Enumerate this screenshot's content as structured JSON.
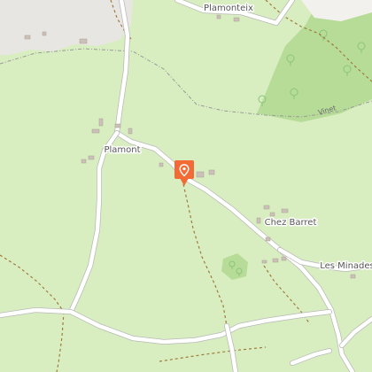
{
  "map": {
    "labels": {
      "plamonteix": "Plamonteix",
      "plamont": "Plamont",
      "chez_barret": "Chez Barret",
      "les_minades": "Les Minades",
      "vinet": "Vinet"
    },
    "marker": {
      "icon": "location-pin-icon",
      "color": "#f26a35"
    },
    "colors": {
      "land": "#d8eec0",
      "forest": "#b6dc98",
      "settlement": "#e8e6e2",
      "road": "#ffffff",
      "track": "#a07a3c"
    }
  }
}
